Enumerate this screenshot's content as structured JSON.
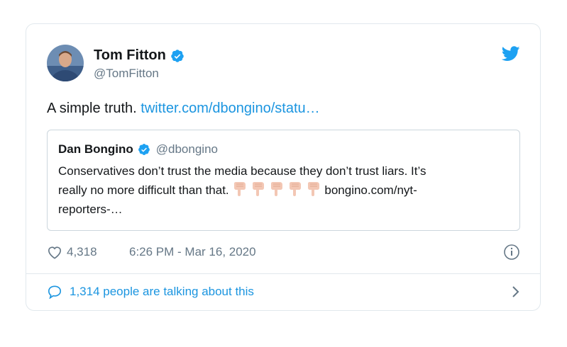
{
  "author": {
    "name": "Tom Fitton",
    "handle": "@TomFitton"
  },
  "tweet": {
    "text": "A simple truth. ",
    "link_text": "twitter.com/dbongino/statu…"
  },
  "quoted_tweet": {
    "name": "Dan Bongino",
    "handle": "@dbongino",
    "text_line1": "Conservatives don’t trust the media because they don’t trust liars. It’s",
    "text_line2_before_emoji": "really no more difficult than that. ",
    "text_line2_after_emoji": "bongino.com/nyt-",
    "text_line3": "reporters-…",
    "emoji": "backhand-index-pointing-down",
    "emoji_count": 5
  },
  "meta": {
    "likes": "4,318",
    "timestamp": "6:26 PM - Mar 16, 2020"
  },
  "footer": {
    "text": "1,314 people are talking about this"
  },
  "colors": {
    "accent": "#1b95e0",
    "verified": "#1da1f2",
    "muted": "#657786",
    "border": "#e1e8ed"
  },
  "icons": [
    "verified-badge-icon",
    "twitter-bird-icon",
    "heart-icon",
    "info-icon",
    "comment-bubble-icon",
    "chevron-right-icon"
  ]
}
